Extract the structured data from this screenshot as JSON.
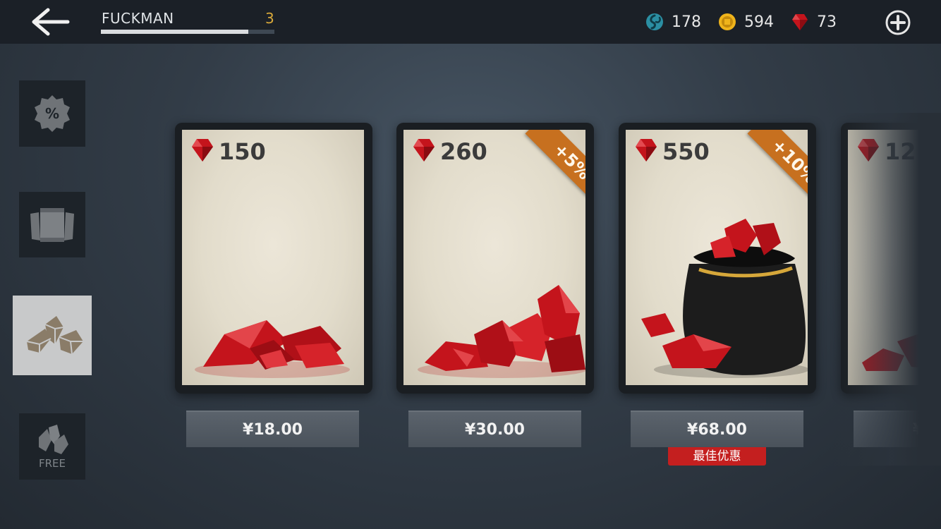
{
  "header": {
    "player_name": "FUCKMAN",
    "player_level": "3",
    "xp_progress": 0.85,
    "currencies": [
      {
        "name": "energy",
        "icon": "swirl-orb-icon",
        "value": "178"
      },
      {
        "name": "coins",
        "icon": "coin-icon",
        "value": "594"
      },
      {
        "name": "gems",
        "icon": "ruby-gem-icon",
        "value": "73"
      }
    ]
  },
  "sidebar": {
    "items": [
      {
        "id": "sale",
        "icon": "percent-badge-icon",
        "active": false
      },
      {
        "id": "card-packs",
        "icon": "card-packs-icon",
        "active": false
      },
      {
        "id": "gems",
        "icon": "gem-crystals-icon",
        "active": true
      },
      {
        "id": "free",
        "icon": "free-crystals-icon",
        "label": "FREE",
        "active": false
      }
    ]
  },
  "shop": {
    "cards": [
      {
        "amount": "150",
        "price": "¥18.00",
        "bonus": "",
        "art": "small-gem-pile"
      },
      {
        "amount": "260",
        "price": "¥30.00",
        "bonus": "+5%",
        "art": "medium-gem-pile"
      },
      {
        "amount": "550",
        "price": "¥68.00",
        "bonus": "+10%",
        "art": "gem-bag",
        "badge": "最佳优惠"
      },
      {
        "amount": "12",
        "price": "¥",
        "bonus": "",
        "art": "gem-pile-partial"
      }
    ]
  },
  "colors": {
    "accent_gold": "#d9a93a",
    "ribbon_orange": "#c7701f",
    "best_deal_red": "#c41f1f",
    "gem_red": "#c4141c"
  }
}
